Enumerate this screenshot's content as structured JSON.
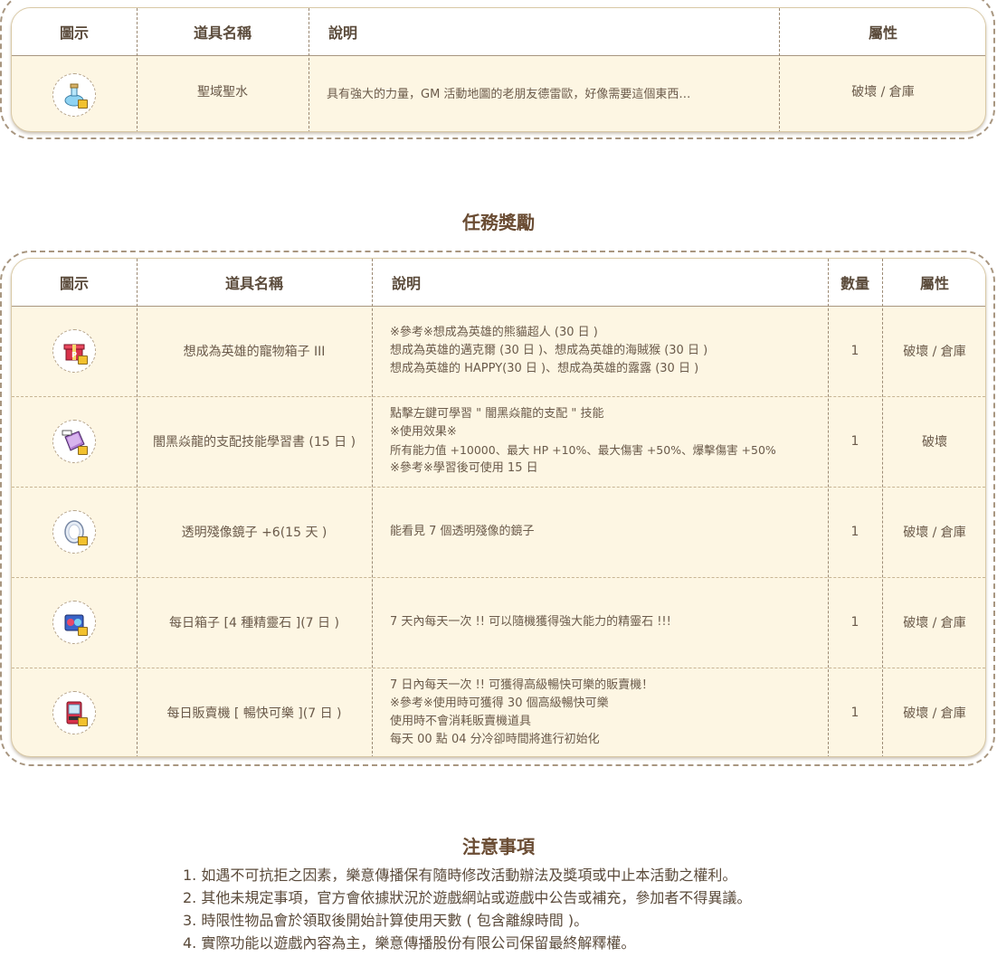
{
  "colors": {
    "panel_bg": "#fdf6e3",
    "frame_border": "#a89680",
    "title_text": "#6a4c33",
    "body_text": "#6a5a4a"
  },
  "table1": {
    "headers": {
      "icon": "圖示",
      "name": "道具名稱",
      "desc": "說明",
      "attr": "屬性"
    },
    "rows": [
      {
        "icon_name": "holy-water-icon",
        "name": "聖域聖水",
        "desc": "具有強大的力量，GM 活動地圖的老朋友德雷歐，好像需要這個東西…",
        "attr": "破壞 / 倉庫"
      }
    ]
  },
  "rewards_title": "任務獎勵",
  "table2": {
    "headers": {
      "icon": "圖示",
      "name": "道具名稱",
      "desc": "說明",
      "qty": "數量",
      "attr": "屬性"
    },
    "rows": [
      {
        "icon_name": "pet-gift-box-icon",
        "name": "想成為英雄的寵物箱子 III",
        "desc": [
          "※參考※想成為英雄的熊貓超人 (30 日 )",
          "想成為英雄的邁克爾 (30 日 )、想成為英雄的海賊猴 (30 日 )",
          "想成為英雄的 HAPPY(30 日 )、想成為英雄的露露 (30 日 )"
        ],
        "qty": "1",
        "attr": "破壞 / 倉庫"
      },
      {
        "icon_name": "skill-book-icon",
        "name": "闇黑焱龍的支配技能學習書 (15 日 )",
        "desc": [
          "點擊左鍵可學習 \" 闇黑焱龍的支配 \" 技能",
          "※使用效果※",
          "所有能力值 +10000、最大 HP +10%、最大傷害 +50%、爆擊傷害 +50%",
          "※參考※學習後可使用 15 日"
        ],
        "qty": "1",
        "attr": "破壞"
      },
      {
        "icon_name": "mirror-icon",
        "name": "透明殘像鏡子 +6(15 天 )",
        "desc": [
          "能看見 7 個透明殘像的鏡子"
        ],
        "qty": "1",
        "attr": "破壞 / 倉庫"
      },
      {
        "icon_name": "spirit-stone-box-icon",
        "name": "每日箱子 [4 種精靈石 ](7 日 )",
        "desc": [
          "7 天內每天一次 !! 可以隨機獲得強大能力的精靈石 !!!"
        ],
        "qty": "1",
        "attr": "破壞 / 倉庫"
      },
      {
        "icon_name": "vending-machine-icon",
        "name": "每日販賣機 [ 暢快可樂 ](7 日 )",
        "desc": [
          "7 日內每天一次 !! 可獲得高級暢快可樂的販賣機！",
          "※參考※使用時可獲得 30 個高級暢快可樂",
          "使用時不會消耗販賣機道具",
          "每天 00 點 04 分冷卻時間將進行初始化"
        ],
        "qty": "1",
        "attr": "破壞 / 倉庫"
      }
    ]
  },
  "notes_title": "注意事項",
  "notes": [
    "1. 如遇不可抗拒之因素，樂意傳播保有隨時修改活動辦法及獎項或中止本活動之權利。",
    "2. 其他未規定事項，官方會依據狀況於遊戲網站或遊戲中公告或補充，參加者不得異議。",
    "3. 時限性物品會於領取後開始計算使用天數 ( 包含離線時間 )。",
    "4. 實際功能以遊戲內容為主，樂意傳播股份有限公司保留最終解釋權。"
  ]
}
